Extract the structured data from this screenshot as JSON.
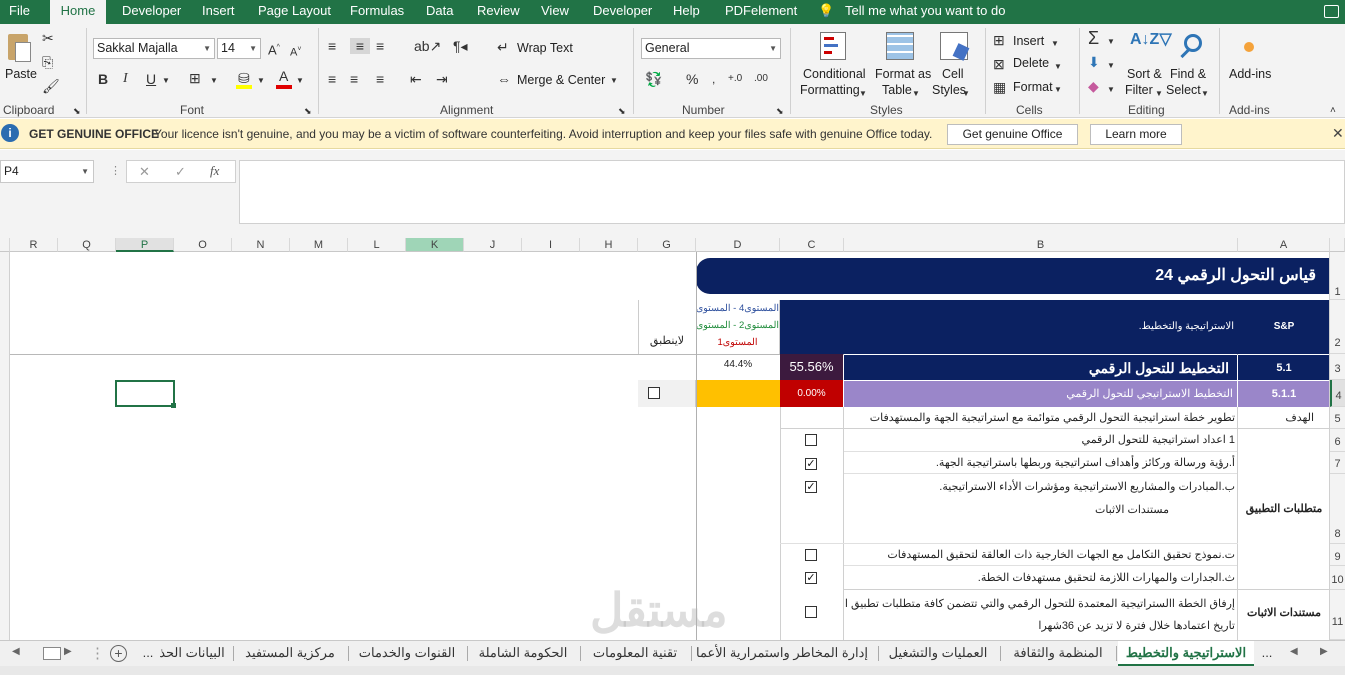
{
  "menu": {
    "file": "File",
    "home": "Home",
    "developer": "Developer",
    "insert": "Insert",
    "page_layout": "Page Layout",
    "formulas": "Formulas",
    "data": "Data",
    "review": "Review",
    "view": "View",
    "developer2": "Developer",
    "help": "Help",
    "pdfelement": "PDFelement",
    "tell_me": "Tell me what you want to do"
  },
  "ribbon": {
    "paste": "Paste",
    "clipboard": "Clipboard",
    "font_name": "Sakkal Majalla",
    "font_size": "14",
    "font_group": "Font",
    "bold": "B",
    "italic": "I",
    "underline": "U",
    "wrap_text": "Wrap Text",
    "merge_center": "Merge & Center",
    "alignment": "Alignment",
    "number_format": "General",
    "number": "Number",
    "percent": "%",
    "conditional_formatting_1": "Conditional",
    "conditional_formatting_2": "Formatting",
    "format_as_table_1": "Format as",
    "format_as_table_2": "Table",
    "cell_styles_1": "Cell",
    "cell_styles_2": "Styles",
    "styles": "Styles",
    "insert": "Insert",
    "delete": "Delete",
    "format": "Format",
    "cells": "Cells",
    "sort_filter_1": "Sort &",
    "sort_filter_2": "Filter",
    "find_select_1": "Find &",
    "find_select_2": "Select",
    "editing": "Editing",
    "add_ins": "Add-ins",
    "add_ins_group": "Add-ins"
  },
  "infobar": {
    "title": "GET GENUINE OFFICE",
    "message": "Your licence isn't genuine, and you may be a victim of software counterfeiting. Avoid interruption and keep your files safe with genuine Office today.",
    "btn_genuine": "Get genuine Office",
    "btn_learn": "Learn more"
  },
  "formula_bar": {
    "name_box": "P4",
    "fx": "fx",
    "formula": ""
  },
  "columns": [
    "R",
    "Q",
    "P",
    "O",
    "N",
    "M",
    "L",
    "K",
    "J",
    "I",
    "H",
    "G",
    "D",
    "C",
    "B",
    "A"
  ],
  "rows": [
    "1",
    "2",
    "3",
    "4",
    "5",
    "6",
    "7",
    "8",
    "9",
    "10",
    "11"
  ],
  "sheet": {
    "title": "قياس التحول الرقمي 24",
    "hdr_sp": "S&P",
    "hdr_strategy": "الاستراتيجية والتخطيط.",
    "hdr_levels_line1": "المستوى4 - المستوى5 -",
    "hdr_levels_line2": "المستوى2 - المستوى3 -",
    "hdr_levels_line3": "المستوى1",
    "hdr_na": "لاينطبق",
    "r3_code": "5.1",
    "r3_title": "التخطيط للتحول الرقمي",
    "r3_pct": "55.56%",
    "r3_level": "44.4%",
    "r4_code": "5.1.1",
    "r4_title": "التخطيط الاستراتيجي للتحول الرقمي",
    "r4_pct": "0.00%",
    "r5_label": "الهدف",
    "r5_text": "تطوير خطة استراتيجية التحول الرقمي متوائمة مع استراتيجية الجهة والمستهدفات",
    "req_label": "متطلبات التطبيق",
    "r6_text": "1 اعداد استراتيجية للتحول الرقمي",
    "r7_text": "أ.رؤية ورسالة وركائز وأهداف استراتيجية وربطها باستراتيجية الجهة.",
    "r8_text": "ب.المبادرات والمشاريع الاستراتيجية ومؤشرات الأداء الاستراتيجية.",
    "r8_sub": "مستندات الاثبات",
    "r9_text": "ت.نموذج تحقيق التكامل مع الجهات الخارجية ذات العالقة لتحقيق المستهدفات",
    "r10_text": "ث.الجدارات والمهارات اللازمة لتحقيق مستهدفات الخطة.",
    "evid_label": "مستندات الاثبات",
    "r11_line1": "إرفاق الخطة االستراتيجية المعتمدة للتحول الرقمي والتي تتضمن كافة متطلبات تطبيق المعيار ويكون",
    "r11_line2": "تاريخ اعتمادها خلال فترة لا تزيد عن 36شهرا",
    "checks": {
      "r6": "",
      "r7": "✓",
      "r8": "✓",
      "r9": "",
      "r10": "✓",
      "r11": ""
    }
  },
  "tabs": {
    "more_left": "...",
    "t1": "الاستراتيجية والتخطيط",
    "t2": "المنظمة والثقافة",
    "t3": "العمليات والتشغيل",
    "t4": "إدارة المخاطر واستمرارية الأعما",
    "t5": "تقنية المعلومات",
    "t6": "الحكومة الشاملة",
    "t7": "القنوات والخدمات",
    "t8": "مركزية المستفيد",
    "t9": "البيانات الحذ",
    "more_right": "..."
  },
  "watermark": "مستقل",
  "colors": {
    "excel_green": "#217346",
    "navy": "#0b2161",
    "purple_row": "#9a86c9",
    "dark_pct": "#3c1a3e",
    "red_pct": "#c00000",
    "yellow_cell": "#ffc000",
    "selected_col": "#9fd5b7"
  }
}
